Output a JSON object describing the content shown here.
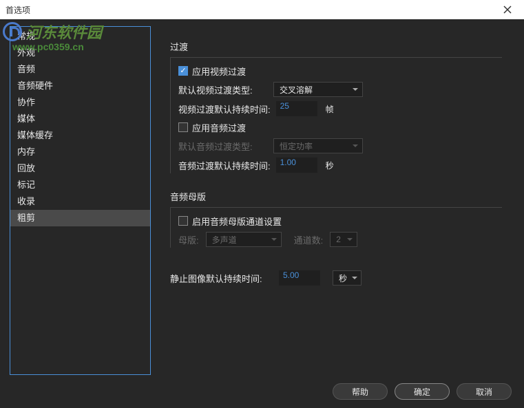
{
  "window": {
    "title": "首选项"
  },
  "watermark": {
    "text": "河东软件园",
    "url": "www.pc0359.cn"
  },
  "sidebar": {
    "items": [
      {
        "label": "常规"
      },
      {
        "label": "外观"
      },
      {
        "label": "音频"
      },
      {
        "label": "音频硬件"
      },
      {
        "label": "协作"
      },
      {
        "label": "媒体"
      },
      {
        "label": "媒体缓存"
      },
      {
        "label": "内存"
      },
      {
        "label": "回放"
      },
      {
        "label": "标记"
      },
      {
        "label": "收录"
      },
      {
        "label": "粗剪"
      }
    ]
  },
  "panel": {
    "transitions": {
      "title": "过渡",
      "apply_video": "应用视频过渡",
      "default_video_type_label": "默认视频过渡类型:",
      "default_video_type_value": "交叉溶解",
      "video_duration_label": "视频过渡默认持续时间:",
      "video_duration_value": "25",
      "video_duration_unit": "帧",
      "apply_audio": "应用音频过渡",
      "default_audio_type_label": "默认音频过渡类型:",
      "default_audio_type_value": "恒定功率",
      "audio_duration_label": "音频过渡默认持续时间:",
      "audio_duration_value": "1.00",
      "audio_duration_unit": "秒"
    },
    "audio_master": {
      "title": "音频母版",
      "enable": "启用音频母版通道设置",
      "master_label": "母版:",
      "master_value": "多声道",
      "channels_label": "通道数:",
      "channels_value": "2"
    },
    "still": {
      "label": "静止图像默认持续时间:",
      "value": "5.00",
      "unit": "秒"
    }
  },
  "footer": {
    "help": "帮助",
    "ok": "确定",
    "cancel": "取消"
  }
}
